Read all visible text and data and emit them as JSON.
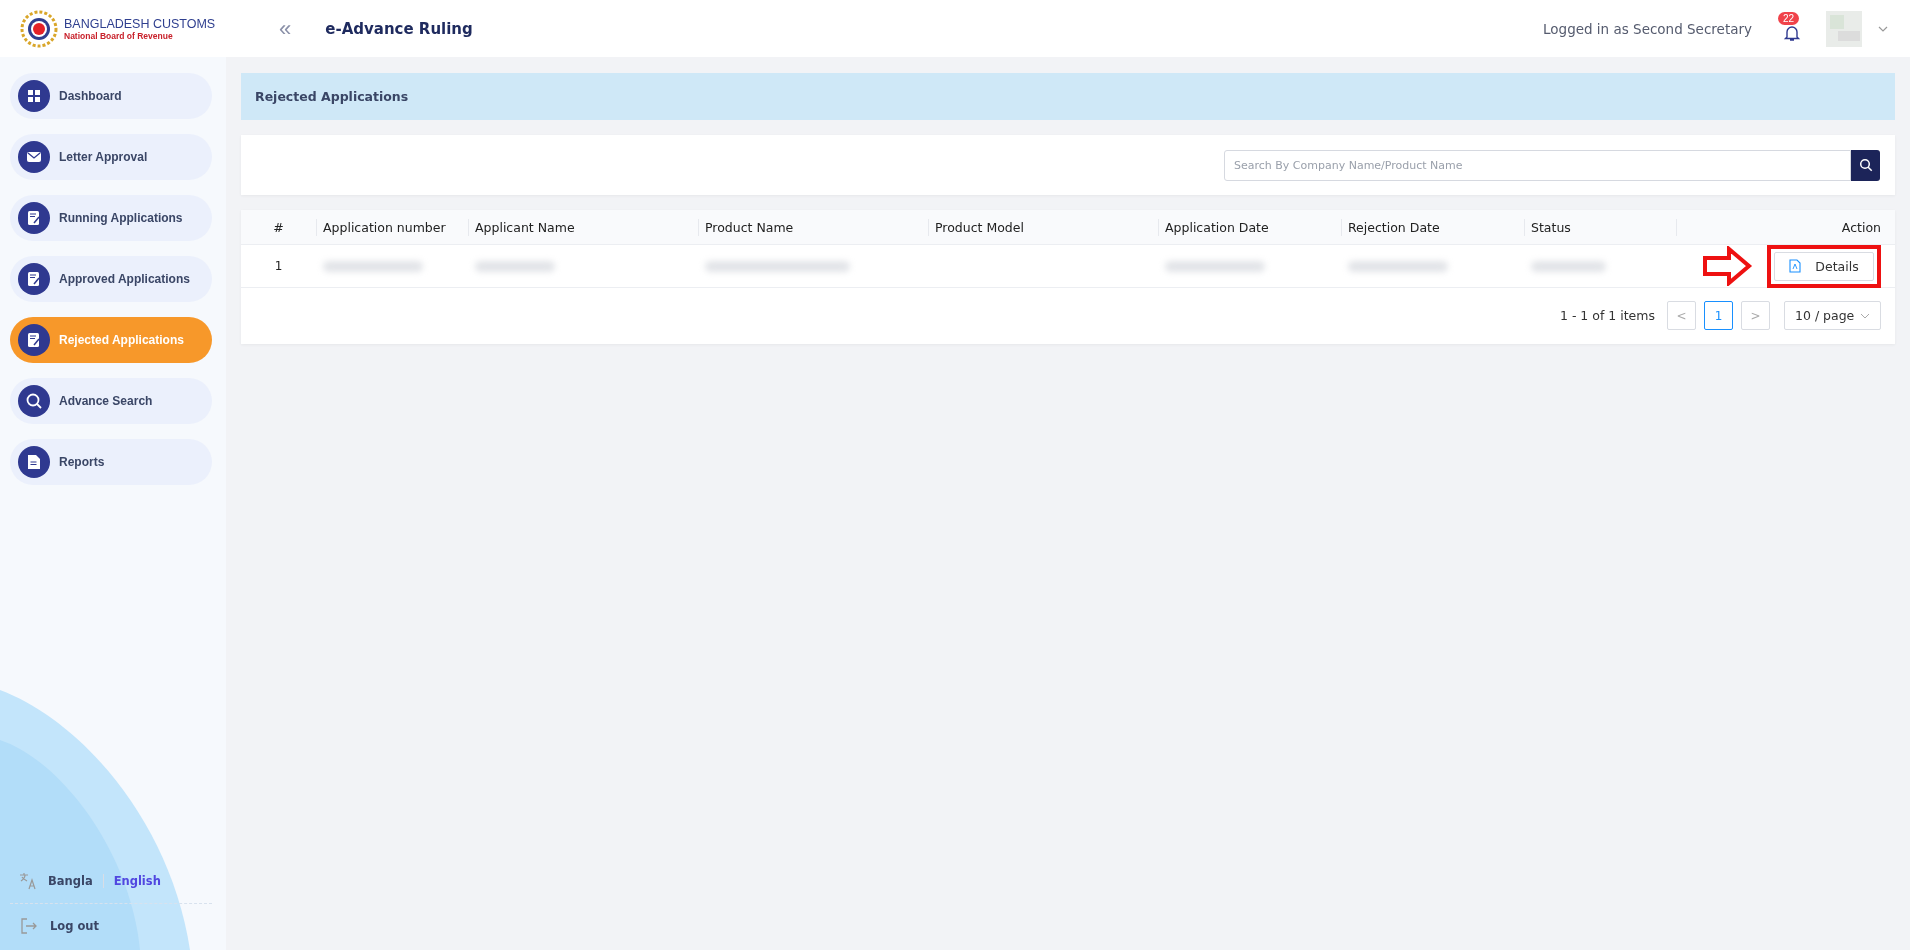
{
  "header": {
    "logo_title": "BANGLADESH CUSTOMS",
    "logo_subtitle": "National Board of Revenue",
    "collapse_icon": "«",
    "app_title": "e-Advance Ruling",
    "user_label": "Logged in as Second Secretary",
    "notification_count": "22"
  },
  "sidebar": {
    "items": [
      {
        "label": "Dashboard",
        "selected": false
      },
      {
        "label": "Letter Approval",
        "selected": false
      },
      {
        "label": "Running Applications",
        "selected": false
      },
      {
        "label": "Approved Applications",
        "selected": false
      },
      {
        "label": "Rejected Applications",
        "selected": true
      },
      {
        "label": "Advance Search",
        "selected": false
      },
      {
        "label": "Reports",
        "selected": false
      }
    ],
    "languages": [
      {
        "label": "Bangla",
        "selected": false
      },
      {
        "label": "English",
        "selected": true
      }
    ],
    "logout": "Log out"
  },
  "page_title": "Rejected Applications",
  "search": {
    "placeholder": "Search By Company Name/Product Name"
  },
  "table": {
    "columns": [
      "#",
      "Application number",
      "Applicant Name",
      "Product Name",
      "Product Model",
      "Application Date",
      "Rejection Date",
      "Status",
      "Action"
    ],
    "rows": [
      {
        "cells": [
          {
            "kind": "text",
            "text": "1"
          },
          {
            "kind": "blurred"
          },
          {
            "kind": "blurred"
          },
          {
            "kind": "blurred"
          },
          {
            "kind": "empty"
          },
          {
            "kind": "blurred"
          },
          {
            "kind": "blurred"
          },
          {
            "kind": "blurred"
          }
        ],
        "action": "Details",
        "highlighted": true
      }
    ]
  },
  "pagination": {
    "summary": "1 - 1 of 1 items",
    "prev": "<",
    "pages": [
      {
        "label": "1",
        "selected": true
      }
    ],
    "next": ">",
    "page_size": "10 / page"
  }
}
